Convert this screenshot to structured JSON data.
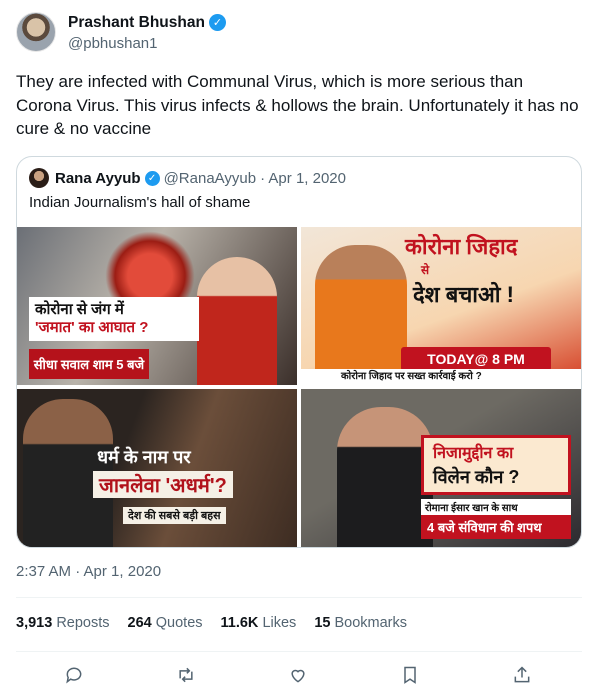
{
  "author": {
    "name": "Prashant Bhushan",
    "handle": "@pbhushan1",
    "verified_icon": "verified-badge"
  },
  "tweet_text": "They are infected with Communal Virus, which is more serious than Corona Virus. This virus infects & hollows the brain. Unfortunately it has no cure & no vaccine",
  "quoted": {
    "name": "Rana Ayyub",
    "handle": "@RanaAyyub",
    "date": "· Apr 1, 2020",
    "text": "Indian Journalism's hall of shame",
    "images": [
      {
        "line1": "कोरोना से जंग में",
        "line2": "'जमात' का आघात ?",
        "logo": "सीधा सवाल  शाम 5 बजे"
      },
      {
        "line1": "कोरोना जिहाद",
        "line2": "से",
        "line3": "देश बचाओ !",
        "badge": "TODAY@ 8 PM",
        "ticker": "कोरोना जिहाद पर सख्त कार्रवाई करो ?"
      },
      {
        "line1": "धर्म के नाम पर",
        "line2": "जानलेवा 'अधर्म'?",
        "line3": "देश की सबसे बड़ी बहस"
      },
      {
        "line1": "निजामुद्दीन का",
        "line2": "विलेन कौन ?",
        "line3": "रोमाना ईसार खान के साथ",
        "badge": "4 बजे  संविधान की शपथ"
      }
    ]
  },
  "timestamp": "2:37 AM · Apr 1, 2020",
  "stats": {
    "reposts_count": "3,913",
    "reposts_label": "Reposts",
    "quotes_count": "264",
    "quotes_label": "Quotes",
    "likes_count": "11.6K",
    "likes_label": "Likes",
    "bookmarks_count": "15",
    "bookmarks_label": "Bookmarks"
  },
  "actions": [
    "reply-icon",
    "repost-icon",
    "like-icon",
    "bookmark-icon",
    "share-icon"
  ]
}
